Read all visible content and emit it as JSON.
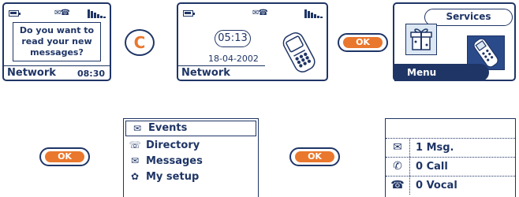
{
  "screen1": {
    "message_lines": [
      "Do you want to",
      "read your new",
      "messages?"
    ],
    "network": "Network",
    "time": "08:30"
  },
  "clear_key": {
    "label": "C"
  },
  "screen2": {
    "clock": "05:13",
    "date": "18-04-2002",
    "network": "Network"
  },
  "ok_button": {
    "label": "OK"
  },
  "screen3": {
    "services_tab": "Services",
    "menu_tab": "Menu"
  },
  "menu_list": [
    {
      "label": "Events",
      "icon": "envelope-phone-icon"
    },
    {
      "label": "Directory",
      "icon": "directory-icon"
    },
    {
      "label": "Messages",
      "icon": "messages-icon"
    },
    {
      "label": "My setup",
      "icon": "setup-icon"
    }
  ],
  "events_list": [
    {
      "label": "1 Msg.",
      "icon": "message-icon"
    },
    {
      "label": "0 Call",
      "icon": "handset-icon"
    },
    {
      "label": "0 Vocal",
      "icon": "voicemail-icon"
    }
  ],
  "colors": {
    "navy": "#1f3566",
    "orange": "#e9772d"
  }
}
